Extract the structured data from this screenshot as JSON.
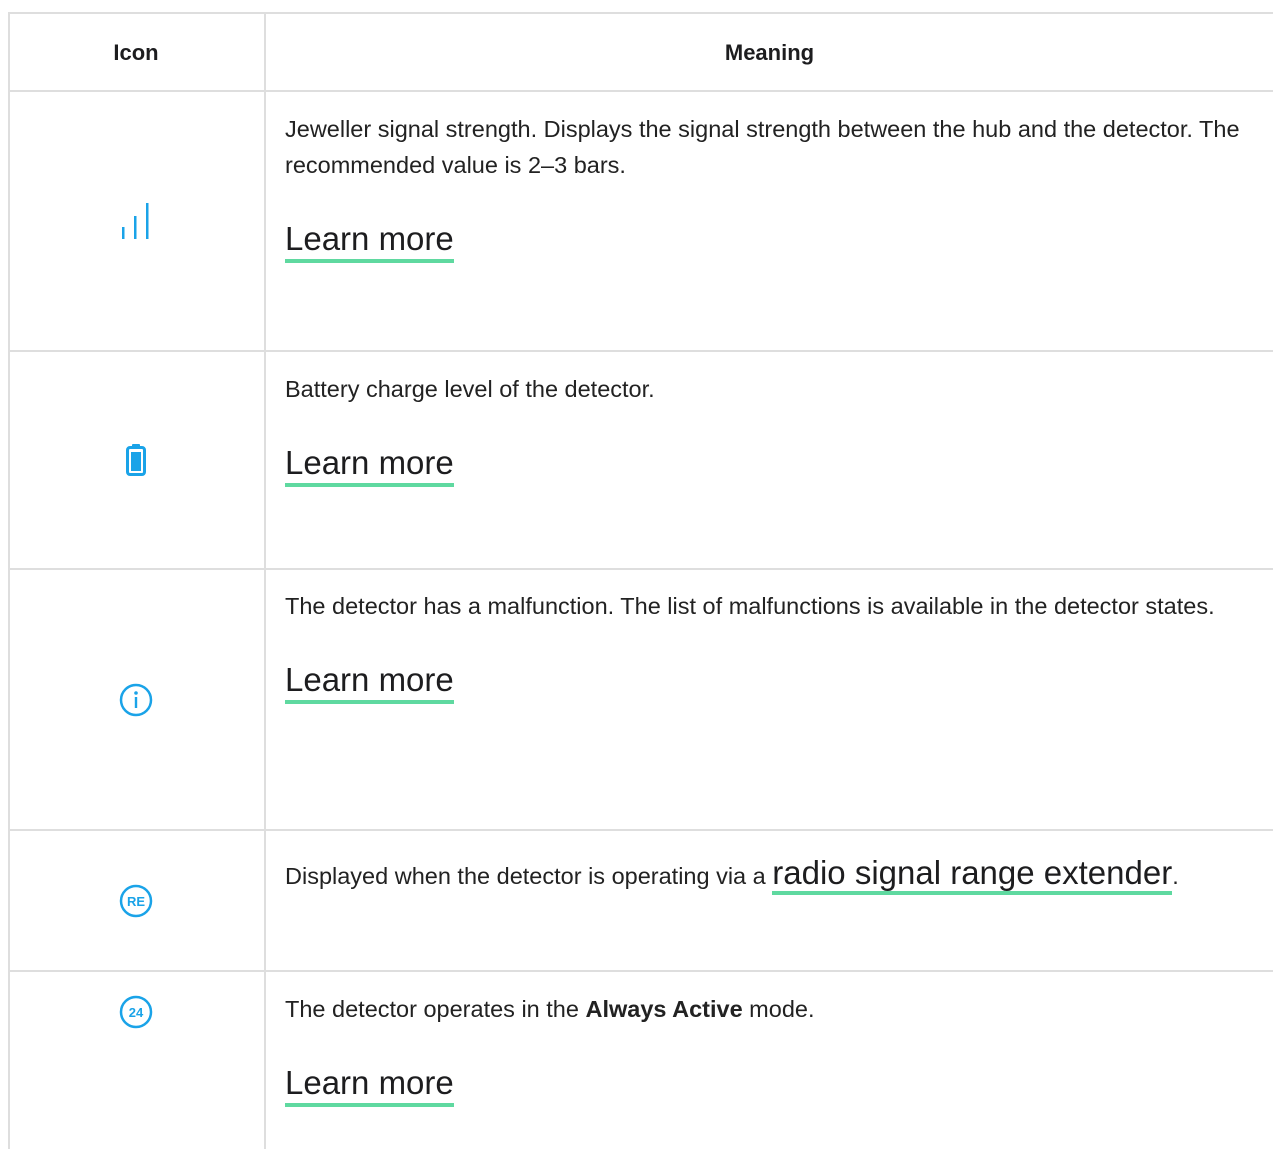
{
  "colors": {
    "accent": "#1aa3e8",
    "underline": "#5fd9a0",
    "border": "#dedede"
  },
  "header": {
    "icon_col": "Icon",
    "meaning_col": "Meaning"
  },
  "rows": [
    {
      "icon": "signal-strength-icon",
      "text": "Jeweller signal strength. Displays the signal strength between the hub and the detector. The recommended value is 2–3 bars.",
      "link": "Learn more"
    },
    {
      "icon": "battery-icon",
      "text": "Battery charge level of the detector.",
      "link": "Learn more"
    },
    {
      "icon": "info-icon",
      "text": "The detector has a malfunction. The list of malfunctions is available in the detector states.",
      "link": "Learn more"
    },
    {
      "icon": "range-extender-icon",
      "text_before": "Displayed when the detector is operating via a ",
      "link": "radio signal range extender",
      "text_after": ".",
      "icon_label": "RE"
    },
    {
      "icon": "always-active-icon",
      "text_before": "The detector operates in the ",
      "bold": "Always Active",
      "text_after": " mode.",
      "link": "Learn more",
      "icon_label": "24"
    }
  ]
}
